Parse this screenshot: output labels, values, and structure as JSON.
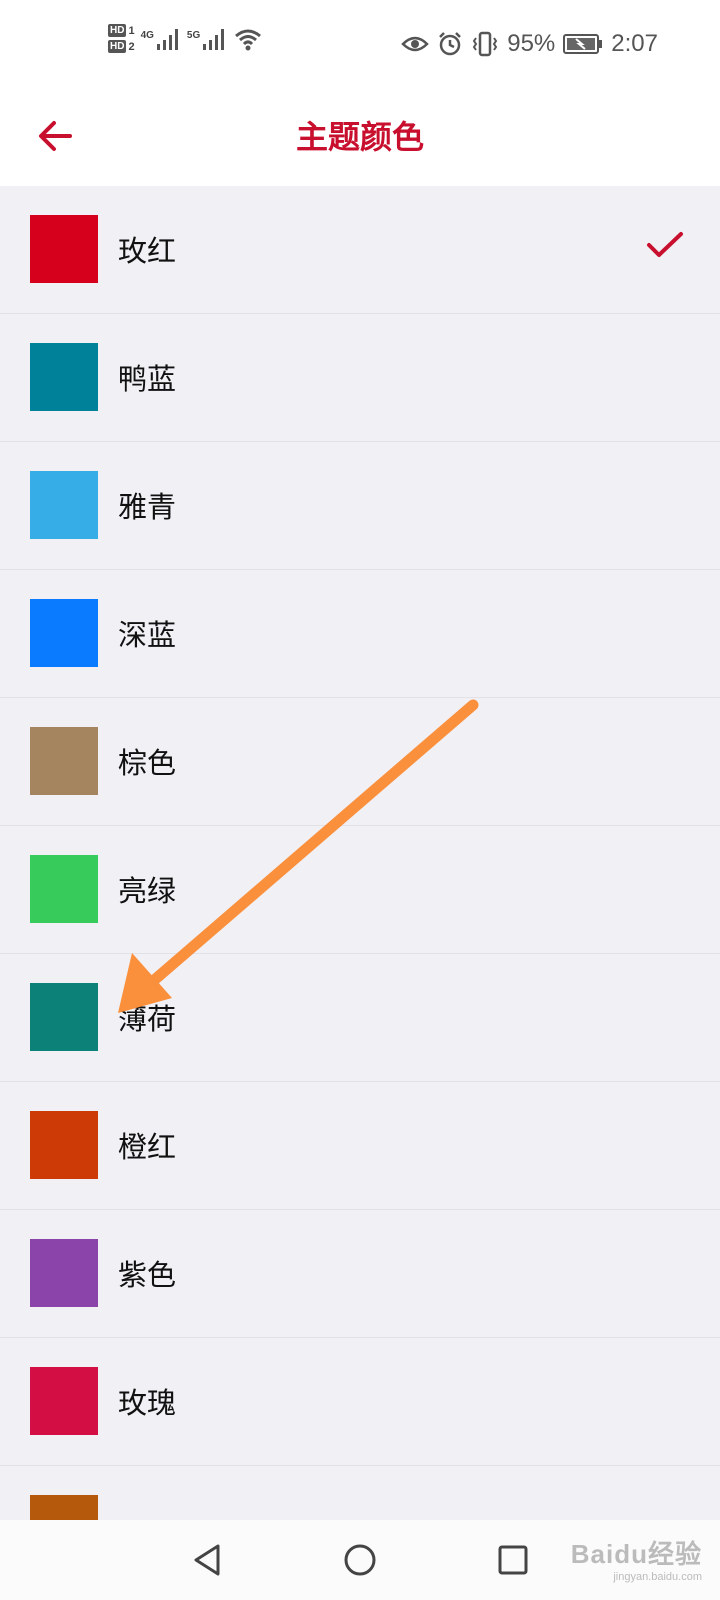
{
  "status_bar": {
    "hd1": "HD",
    "hd1_sub": "1",
    "hd2": "HD",
    "hd2_sub": "2",
    "net1": "4G",
    "net2": "5G",
    "battery_percent": "95%",
    "time": "2:07",
    "icons": [
      "eye-icon",
      "alarm-icon",
      "vibrate-icon",
      "battery-charging-icon",
      "wifi-icon",
      "signal-icon"
    ]
  },
  "header": {
    "title": "主题颜色",
    "back_icon": "arrow-left-icon",
    "accent_color": "#c8102e"
  },
  "themes": [
    {
      "label": "玫红",
      "color": "#d6001c",
      "selected": true
    },
    {
      "label": "鸭蓝",
      "color": "#00819a",
      "selected": false
    },
    {
      "label": "雅青",
      "color": "#36ade6",
      "selected": false
    },
    {
      "label": "深蓝",
      "color": "#0a7afe",
      "selected": false
    },
    {
      "label": "棕色",
      "color": "#a48560",
      "selected": false
    },
    {
      "label": "亮绿",
      "color": "#37cb5c",
      "selected": false
    },
    {
      "label": "薄荷",
      "color": "#0c8177",
      "selected": false
    },
    {
      "label": "橙红",
      "color": "#cd3a06",
      "selected": false
    },
    {
      "label": "紫色",
      "color": "#8b44aa",
      "selected": false
    },
    {
      "label": "玫瑰",
      "color": "#d30e45",
      "selected": false
    },
    {
      "label": "",
      "color": "#b55a0c",
      "selected": false
    }
  ],
  "nav_bar": {
    "icons": [
      "back-triangle-icon",
      "home-circle-icon",
      "recents-square-icon"
    ]
  },
  "watermark": {
    "logo": "Baidu经验",
    "url": "jingyan.baidu.com"
  },
  "annotation_arrow_color": "#fa8f3c"
}
